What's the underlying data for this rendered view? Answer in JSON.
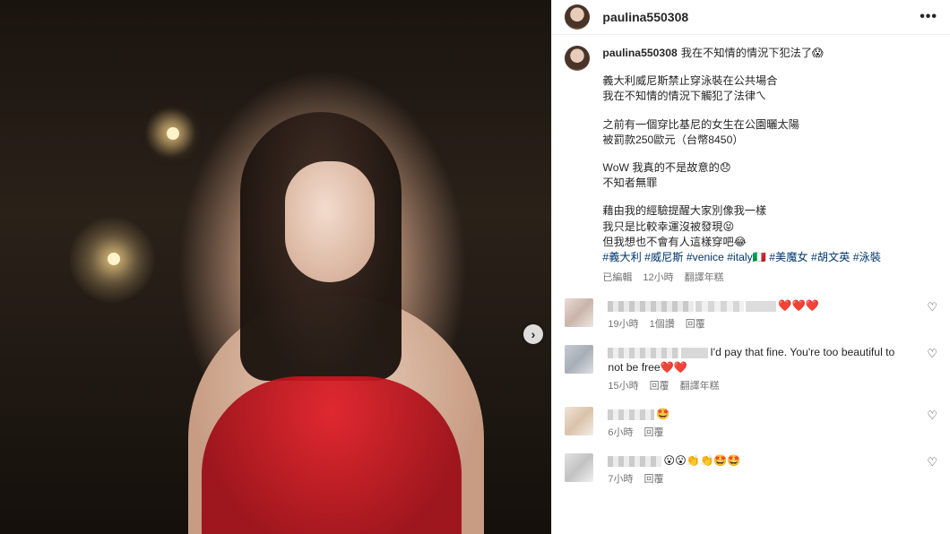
{
  "header": {
    "username": "paulina550308",
    "more_icon": "more-horizontal-icon"
  },
  "caption": {
    "username": "paulina550308",
    "first_line": "我在不知情的情況下犯法了😱",
    "paragraphs": [
      [
        "義大利威尼斯禁止穿泳裝在公共場合",
        "我在不知情的情況下觸犯了法律ㄟ"
      ],
      [
        "之前有一個穿比基尼的女生在公園曬太陽",
        "被罰款250歐元（台幣8450）"
      ],
      [
        "WoW 我真的不是故意的😞",
        "不知者無罪"
      ],
      [
        "藉由我的經驗提醒大家別像我一樣",
        "我只是比較幸運沒被發現😝",
        "但我想也不會有人這樣穿吧😂"
      ]
    ],
    "hashtags": "#義大利 #威尼斯 #venice #italy🇮🇹 #美魔女 #胡文英 #泳裝",
    "edited": "已編輯",
    "time": "12小時",
    "see_translation": "翻譯年糕"
  },
  "comments": [
    {
      "text": "❤️❤️❤️",
      "time": "19小時",
      "likes": "1個讚",
      "reply": "回覆",
      "translate": ""
    },
    {
      "text": "I'd pay that fine. You're too beautiful to not be free❤️❤️",
      "time": "15小時",
      "likes": "",
      "reply": "回覆",
      "translate": "翻譯年糕"
    },
    {
      "text": "🤩",
      "time": "6小時",
      "likes": "",
      "reply": "回覆",
      "translate": ""
    },
    {
      "text": "😮😮👏👏🤩🤩",
      "time": "7小時",
      "likes": "",
      "reply": "回覆",
      "translate": ""
    }
  ],
  "icons": {
    "next": "chevron-right-icon",
    "like": "heart-outline-icon"
  }
}
